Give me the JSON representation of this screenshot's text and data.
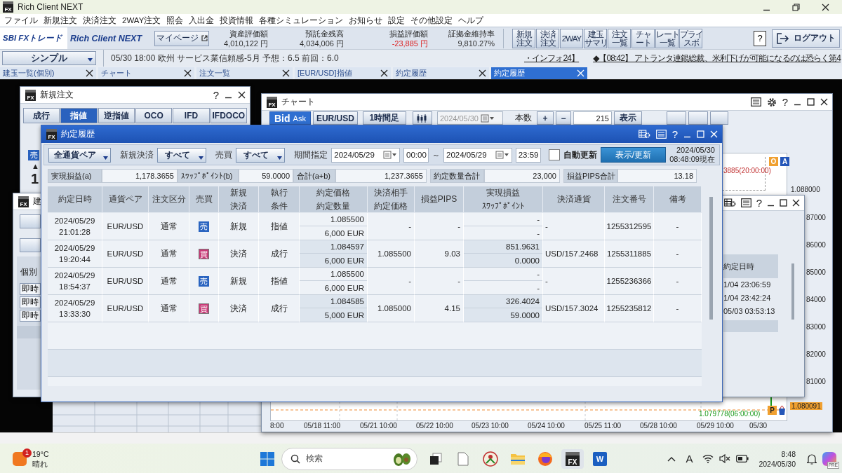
{
  "app": {
    "logo": "FX",
    "title": "Rich Client NEXT"
  },
  "menu": [
    "ファイル",
    "新規注文",
    "決済注文",
    "2WAY注文",
    "照会",
    "入出金",
    "投資情報",
    "各種シミュレーション",
    "お知らせ",
    "設定",
    "その他設定",
    "ヘルプ"
  ],
  "header": {
    "brand": "SBI FXトレード",
    "product": "Rich Client NEXT",
    "mypage": "マイページ",
    "stats": [
      {
        "label": "資産評価額",
        "value": "4,010,122 円",
        "kind": "plain"
      },
      {
        "label": "預託金残高",
        "value": "4,034,006 円",
        "kind": "plain"
      },
      {
        "label": "損益評価額",
        "value": "-23,885 円",
        "kind": "negative"
      },
      {
        "label": "証拠金維持率",
        "value": "9,810.27%",
        "kind": "plain"
      }
    ],
    "tools": [
      [
        "新規",
        "注文"
      ],
      [
        "決済",
        "注文"
      ],
      [
        "2WAY"
      ],
      [
        "建玉",
        "サマリ"
      ],
      [
        "注文",
        "一覧"
      ],
      [
        "チャ",
        "ート"
      ],
      [
        "レート",
        "一覧"
      ],
      [
        "プライ",
        "スボ"
      ]
    ],
    "help": "?",
    "logout": "ログアウト"
  },
  "info": {
    "layout": "シンプル",
    "news": "05/30 18:00 欧州 サービス業信頼感-5月 予想：6.5 前回：6.0",
    "ticker": [
      "・インフォ24】",
      "◆【08:42】 アトランタ連銀総裁、米利下げが可能になるのは恐らく第4"
    ]
  },
  "tabs": [
    {
      "label": "建玉一覧(個別)",
      "selected": false
    },
    {
      "label": "チャート",
      "selected": false
    },
    {
      "label": "注文一覧",
      "selected": false
    },
    {
      "label": "[EUR/USD]指値",
      "selected": false
    },
    {
      "label": "約定履歴",
      "selected": false
    },
    {
      "label": "約定履歴",
      "selected": true
    }
  ],
  "order_window": {
    "logo": "FX",
    "title": "新規注文",
    "help": "?",
    "tabs": [
      {
        "label": "成行",
        "selected": false
      },
      {
        "label": "指値",
        "selected": true
      },
      {
        "label": "逆指値",
        "selected": false
      },
      {
        "label": "OCO",
        "selected": false
      },
      {
        "label": "IFD",
        "selected": false
      },
      {
        "label": "IFDOCO",
        "selected": false
      }
    ],
    "side": "売",
    "arrow": "▲",
    "amount": "1"
  },
  "positions_window": {
    "logo": "FX",
    "title": "建",
    "view": "個別",
    "rows": [
      "即時",
      "即時",
      "即時"
    ]
  },
  "chart_window": {
    "logo": "FX",
    "title": "チャート",
    "help": "?",
    "price_side": [
      {
        "label": "Bid",
        "selected": true
      },
      {
        "label": "Ask",
        "selected": false
      }
    ],
    "pair": "EUR/USD",
    "period": "1時間足",
    "date": {
      "value": "2024/05/30",
      "disabled": true
    },
    "count_label": "本数",
    "plus": "+",
    "minus": "−",
    "count": "215",
    "show": "表示",
    "top_label": "3885(20:00:00)",
    "markers": [
      {
        "label": "O",
        "color": "#f0a030"
      },
      {
        "label": "A",
        "color": "#2456b8"
      }
    ],
    "y_labels": [
      "1.088000",
      "87000",
      "86000",
      "85000",
      "84000",
      "83000",
      "82000",
      "81000"
    ],
    "price_tag": "1.080091",
    "low_label": "1.079778(06:00:00)",
    "pin": "P",
    "x_labels": [
      "8:00",
      "05/18 11:00",
      "05/21 10:00",
      "05/22 10:00",
      "05/23 10:00",
      "05/24 10:00",
      "05/25 11:00",
      "05/28 10:00",
      "05/29 10:00",
      "05/30"
    ]
  },
  "side_window": {
    "help": "?",
    "column": "約定日時",
    "times": [
      "1/04 23:06:59",
      "1/04 23:42:24",
      "05/03 03:53:13"
    ]
  },
  "trades": {
    "logo": "FX",
    "title": "約定履歴",
    "help": "?",
    "pair_filter": "全通貨ペア",
    "open_close_label": "新規決済",
    "open_close": "すべて",
    "side_label": "売買",
    "side": "すべて",
    "period_label": "期間指定",
    "from_date": "2024/05/29",
    "from_time": "00:00",
    "tilde": "～",
    "to_date": "2024/05/29",
    "to_time": "23:59",
    "auto_refresh": {
      "label": "自動更新",
      "checked": false
    },
    "refresh": "表示/更新",
    "asof_date": "2024/05/30",
    "asof_time": "08:48:09現在",
    "summary": [
      {
        "label": "実現損益(a)",
        "value": "1,178.3655"
      },
      {
        "label": "ｽﾜｯﾌﾟﾎﾟｲﾝﾄ(b)",
        "value": "59.0000"
      },
      {
        "label": "合計(a+b)",
        "value": "1,237.3655"
      },
      {
        "label": "約定数量合計",
        "value": "23,000"
      },
      {
        "label": "損益PIPS合計",
        "value": "13.18"
      }
    ],
    "columns": [
      [
        "約定日時"
      ],
      [
        "通貨ペア"
      ],
      [
        "注文区分"
      ],
      [
        "売買"
      ],
      [
        "新規",
        "決済"
      ],
      [
        "執行",
        "条件"
      ],
      [
        "約定価格",
        "約定数量"
      ],
      [
        "決済相手",
        "約定価格"
      ],
      [
        "損益PIPS"
      ],
      [
        "実現損益",
        "ｽﾜｯﾌﾟﾎﾟｲﾝﾄ"
      ],
      [
        "決済通貨"
      ],
      [
        "注文番号"
      ],
      [
        "備考"
      ]
    ],
    "rows": [
      {
        "datetime": "2024/05/29 21:01:28",
        "pair": "EUR/USD",
        "type": "通常",
        "side": "売",
        "kind": "sell",
        "open_close": "新規",
        "condition": "指値",
        "price": "1.085500",
        "quantity": "6,000 EUR",
        "counter_price": "-",
        "pips": "-",
        "pnl": "-",
        "swap": "-",
        "currency": "-",
        "order_no": "1255312595",
        "note": "-"
      },
      {
        "datetime": "2024/05/29 19:20:44",
        "pair": "EUR/USD",
        "type": "通常",
        "side": "買",
        "kind": "buy",
        "open_close": "決済",
        "condition": "成行",
        "price": "1.084597",
        "quantity": "6,000 EUR",
        "counter_price": "1.085500",
        "pips": "9.03",
        "pnl": "851.9631",
        "swap": "0.0000",
        "currency": "USD/157.2468",
        "order_no": "1255311885",
        "note": "-"
      },
      {
        "datetime": "2024/05/29 18:54:37",
        "pair": "EUR/USD",
        "type": "通常",
        "side": "売",
        "kind": "sell",
        "open_close": "新規",
        "condition": "指値",
        "price": "1.085500",
        "quantity": "6,000 EUR",
        "counter_price": "-",
        "pips": "-",
        "pnl": "-",
        "swap": "-",
        "currency": "-",
        "order_no": "1255236366",
        "note": "-"
      },
      {
        "datetime": "2024/05/29 13:33:30",
        "pair": "EUR/USD",
        "type": "通常",
        "side": "買",
        "kind": "buy",
        "open_close": "決済",
        "condition": "成行",
        "price": "1.084585",
        "quantity": "5,000 EUR",
        "counter_price": "1.085000",
        "pips": "4.15",
        "pnl": "326.4024",
        "swap": "59.0000",
        "currency": "USD/157.3024",
        "order_no": "1255235812",
        "note": "-"
      }
    ]
  },
  "taskbar": {
    "weather": {
      "badge": "1",
      "temp": "19°C",
      "condition": "晴れ"
    },
    "search": {
      "placeholder": "検索"
    },
    "fx_label": "FX",
    "word_label": "W",
    "ime": "A",
    "time": "8:48",
    "date": "2024/05/30",
    "copilot_badge": "PRE"
  }
}
